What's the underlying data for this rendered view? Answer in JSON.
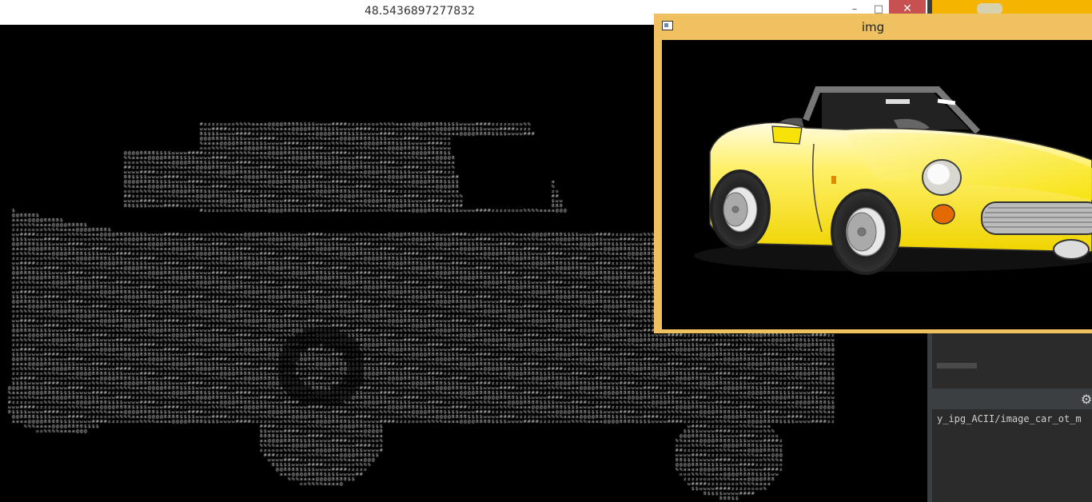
{
  "main_window": {
    "title": "48.5436897277832",
    "min_icon": "minimize-icon",
    "max_icon": "maximize-icon",
    "close_icon": "close-icon",
    "ascii_glyphs": "z#w$8@a%o"
  },
  "image_window": {
    "title": "img",
    "app_icon": "window-app-icon",
    "car_color": "#f7e60a"
  },
  "ide": {
    "path_text": "y_ipg_ACII/image_car_ot_m",
    "gear_icon": "gear-icon",
    "accent": "#f5b400"
  }
}
